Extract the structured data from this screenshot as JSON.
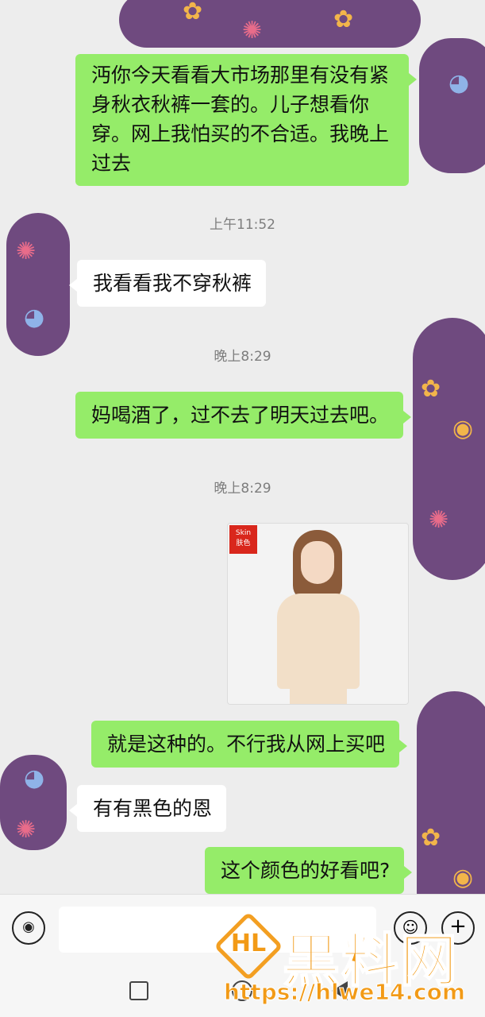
{
  "messages": [
    {
      "type": "out",
      "text_lines": [
        "沔你今天看看大市场那里有没有紧",
        "身秋衣秋裤一套的。儿子想看你",
        "穿。网上我怕买的不合适。我晚上",
        "过去"
      ]
    },
    {
      "type": "time",
      "text": "上午11:52"
    },
    {
      "type": "in",
      "text": "我看看我不穿秋裤"
    },
    {
      "type": "time",
      "text": "晚上8:29"
    },
    {
      "type": "out",
      "text": "妈喝酒了，过不去了明天过去吧。"
    },
    {
      "type": "time",
      "text": "晚上8:29"
    },
    {
      "type": "image",
      "tag_line1": "Skin",
      "tag_line2": "肤色"
    },
    {
      "type": "out",
      "text": "就是这种的。不行我从网上买吧"
    },
    {
      "type": "in",
      "text": "有有黑色的恩"
    },
    {
      "type": "out",
      "text": "这个颜色的好看吧?"
    }
  ],
  "input_bar": {
    "voice_icon": "voice-icon",
    "emoji_icon": "emoji-icon",
    "plus_icon": "plus-icon",
    "voice_glyph": "◉",
    "emoji_glyph": "☺",
    "plus_glyph": "+"
  },
  "watermark": {
    "logo_text": "HL",
    "title": "黑料网",
    "url": "https://hlwe14.com"
  },
  "colors": {
    "outgoing_bubble": "#95ec69",
    "incoming_bubble": "#ffffff",
    "background": "#ededed",
    "avatar_purple": "#6f4a7f",
    "watermark_orange": "#f29a16"
  }
}
